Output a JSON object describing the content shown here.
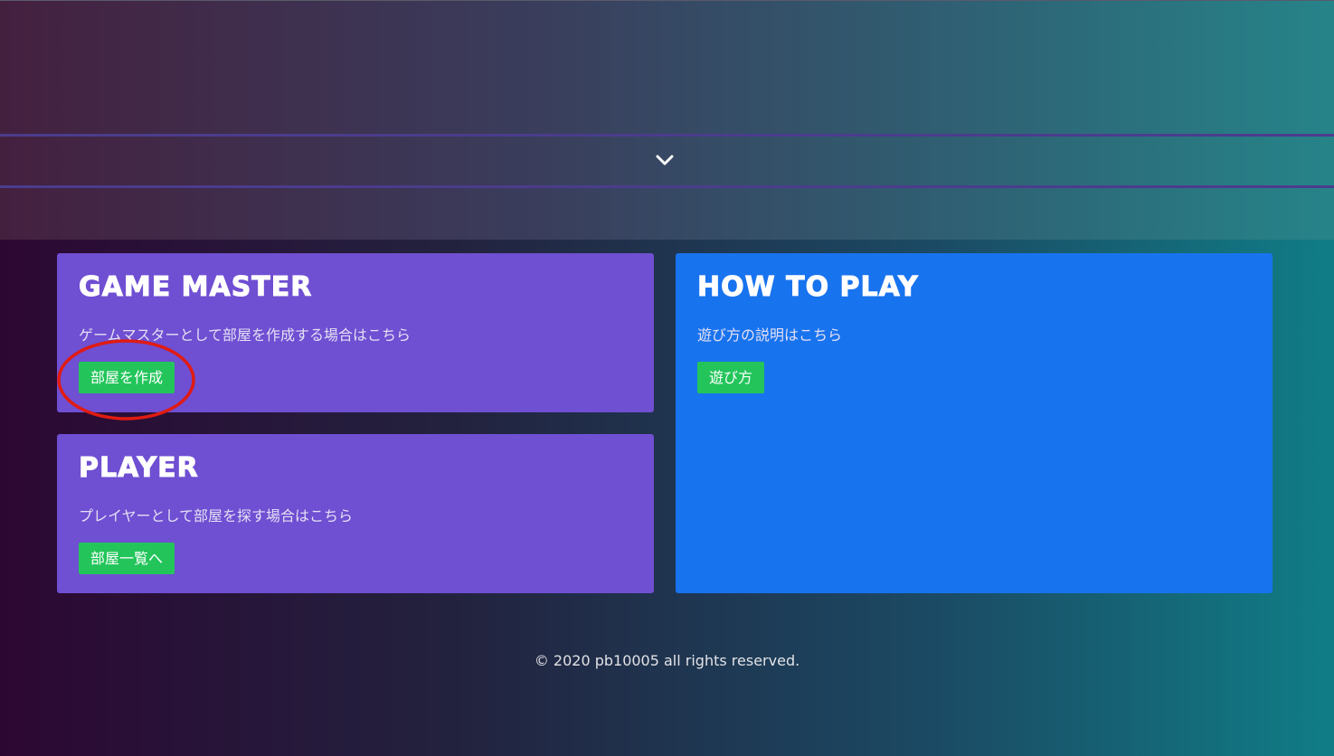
{
  "hero": {
    "scroll_icon": "chevron-down-icon"
  },
  "cards": {
    "game_master": {
      "title": "GAME MASTER",
      "description": "ゲームマスターとして部屋を作成する場合はこちら",
      "button_label": "部屋を作成"
    },
    "player": {
      "title": "PLAYER",
      "description": "プレイヤーとして部屋を探す場合はこちら",
      "button_label": "部屋一覧へ"
    },
    "how_to_play": {
      "title": "HOW TO PLAY",
      "description": "遊び方の説明はこちら",
      "button_label": "遊び方"
    }
  },
  "footer": {
    "copyright": "© 2020 pb10005 all rights reserved."
  },
  "colors": {
    "card_purple": "#6f4fd2",
    "card_blue": "#1873ee",
    "button_green": "#23c55b",
    "annotation_red": "#e01b12"
  }
}
